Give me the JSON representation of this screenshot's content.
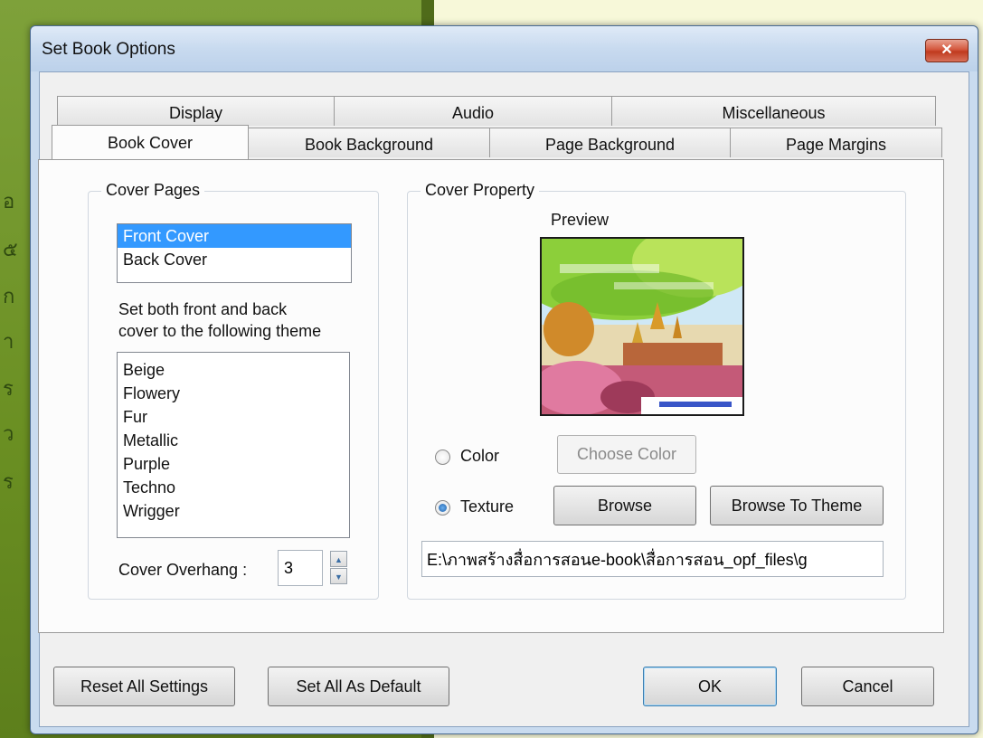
{
  "window": {
    "title": "Set Book Options",
    "close_label": "✕"
  },
  "tabs_top": [
    "Display",
    "Audio",
    "Miscellaneous"
  ],
  "tabs_bottom": [
    "Book Cover",
    "Book Background",
    "Page Background",
    "Page Margins"
  ],
  "cover_pages": {
    "group_label": "Cover Pages",
    "pages": [
      "Front Cover",
      "Back Cover"
    ],
    "selected": "Front Cover",
    "theme_prompt_line1": "Set both front and back",
    "theme_prompt_line2": "cover to the following theme",
    "themes": [
      "Beige",
      "Flowery",
      "Fur",
      "Metallic",
      "Purple",
      "Techno",
      "Wrigger"
    ],
    "overhang_label": "Cover Overhang :",
    "overhang_value": "3"
  },
  "cover_property": {
    "group_label": "Cover Property",
    "preview_label": "Preview",
    "color_label": "Color",
    "texture_label": "Texture",
    "selected_option": "Texture",
    "choose_color_label": "Choose Color",
    "browse_label": "Browse",
    "browse_theme_label": "Browse To Theme",
    "texture_path": "E:\\ภาพสร้างสื่อการสอนe-book\\สื่อการสอน_opf_files\\g"
  },
  "footer": {
    "reset_label": "Reset All Settings",
    "default_label": "Set All As Default",
    "ok_label": "OK",
    "cancel_label": "Cancel"
  },
  "colors": {
    "accent": "#3399ff",
    "titlebar": "#c8daef",
    "close": "#c03a1e"
  }
}
